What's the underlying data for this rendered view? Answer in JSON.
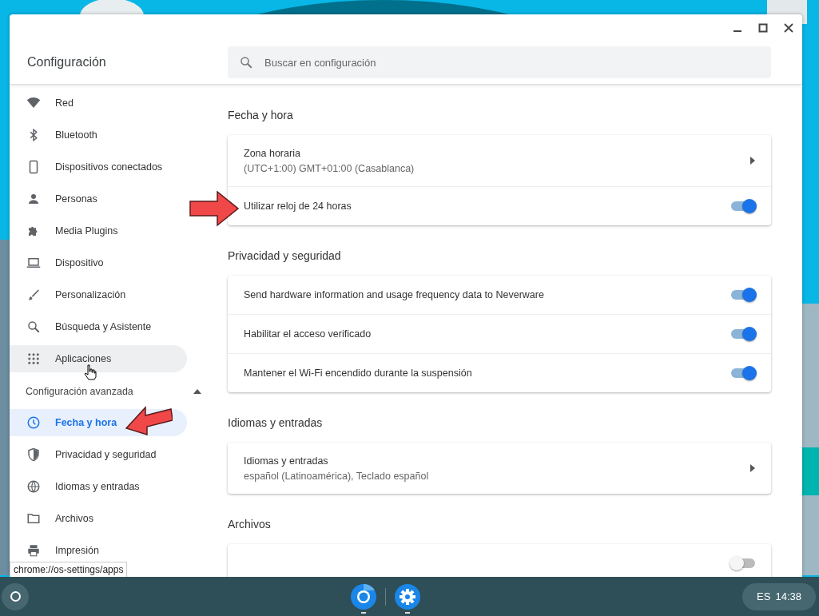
{
  "window": {
    "title": "Configuración",
    "search": {
      "placeholder": "Buscar en configuración"
    }
  },
  "sidebar": {
    "items": [
      {
        "label": "Red",
        "selected": false,
        "hovered": false
      },
      {
        "label": "Bluetooth",
        "selected": false,
        "hovered": false
      },
      {
        "label": "Dispositivos conectados",
        "selected": false,
        "hovered": false
      },
      {
        "label": "Personas",
        "selected": false,
        "hovered": false
      },
      {
        "label": "Media Plugins",
        "selected": false,
        "hovered": false
      },
      {
        "label": "Dispositivo",
        "selected": false,
        "hovered": false
      },
      {
        "label": "Personalización",
        "selected": false,
        "hovered": false
      },
      {
        "label": "Búsqueda y Asistente",
        "selected": false,
        "hovered": false
      },
      {
        "label": "Aplicaciones",
        "selected": false,
        "hovered": true
      }
    ],
    "advanced": {
      "label": "Configuración avanzada",
      "expanded": true,
      "items": [
        {
          "label": "Fecha y hora",
          "selected": true,
          "hovered": false
        },
        {
          "label": "Privacidad y seguridad",
          "selected": false,
          "hovered": false
        },
        {
          "label": "Idiomas y entradas",
          "selected": false,
          "hovered": false
        },
        {
          "label": "Archivos",
          "selected": false,
          "hovered": false
        },
        {
          "label": "Impresión",
          "selected": false,
          "hovered": false
        }
      ]
    }
  },
  "sections": [
    {
      "title": "Fecha y hora",
      "rows": [
        {
          "kind": "link",
          "label": "Zona horaria",
          "sublabel": "(UTC+1:00) GMT+01:00 (Casablanca)"
        },
        {
          "kind": "toggle",
          "label": "Utilizar reloj de 24 horas",
          "on": true
        }
      ]
    },
    {
      "title": "Privacidad y seguridad",
      "rows": [
        {
          "kind": "toggle",
          "label": "Send hardware information and usage frequency data to Neverware",
          "on": true
        },
        {
          "kind": "toggle",
          "label": "Habilitar el acceso verificado",
          "on": true
        },
        {
          "kind": "toggle",
          "label": "Mantener el Wi-Fi encendido durante la suspensión",
          "on": true
        }
      ]
    },
    {
      "title": "Idiomas y entradas",
      "rows": [
        {
          "kind": "link",
          "label": "Idiomas y entradas",
          "sublabel": "español (Latinoamérica), Teclado español"
        }
      ]
    },
    {
      "title": "Archivos",
      "rows": [
        {
          "kind": "toggle",
          "on": false
        }
      ]
    }
  ],
  "tooltip": "chrome://os-settings/apps",
  "taskbar": {
    "apps": [
      {
        "active": true
      },
      {
        "active": true
      }
    ],
    "tray": {
      "language": "ES",
      "time": "14:38"
    }
  }
}
